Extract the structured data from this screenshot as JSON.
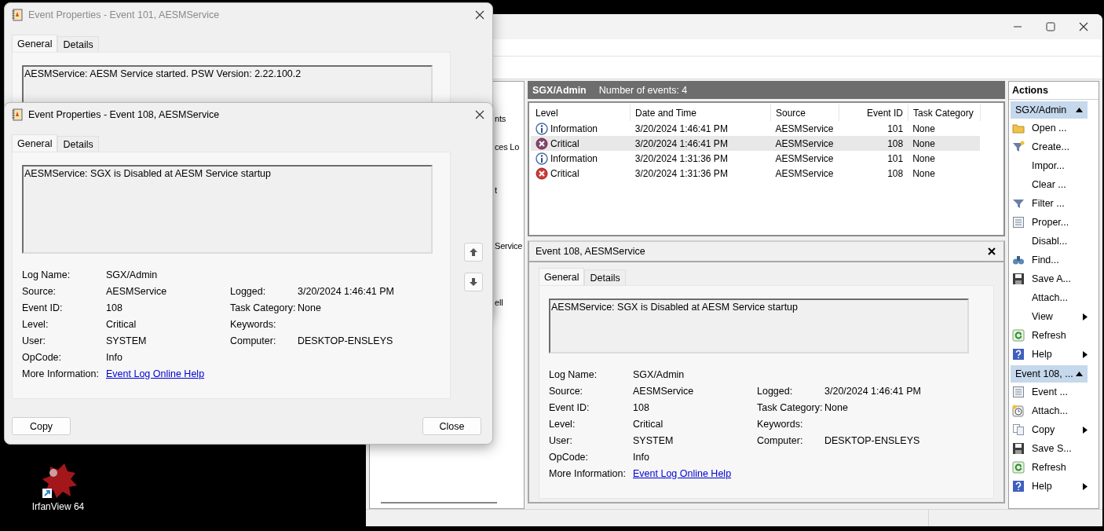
{
  "desktop": {
    "shortcut": {
      "label": "IrfanView 64"
    }
  },
  "event_viewer": {
    "tree": {
      "items": [
        "nts",
        "ces Lo",
        "t",
        "Service",
        "ell"
      ]
    },
    "log": {
      "name": "SGX/Admin",
      "summary": "Number of events: 4"
    },
    "columns": [
      "Level",
      "Date and Time",
      "Source",
      "Event ID",
      "Task Category"
    ],
    "rows": [
      {
        "kind": "information",
        "level": "Information",
        "date": "3/20/2024 1:46:41 PM",
        "source": "AESMService",
        "event_id": "101",
        "task_category": "None",
        "selected": false
      },
      {
        "kind": "critical",
        "level": "Critical",
        "date": "3/20/2024 1:46:41 PM",
        "source": "AESMService",
        "event_id": "108",
        "task_category": "None",
        "selected": true
      },
      {
        "kind": "information",
        "level": "Information",
        "date": "3/20/2024 1:31:36 PM",
        "source": "AESMService",
        "event_id": "101",
        "task_category": "None",
        "selected": false
      },
      {
        "kind": "critical",
        "level": "Critical",
        "date": "3/20/2024 1:31:36 PM",
        "source": "AESMService",
        "event_id": "108",
        "task_category": "None",
        "selected": false
      }
    ],
    "preview": {
      "title": "Event 108, AESMService",
      "tabs": [
        {
          "label": "General",
          "selected": true
        },
        {
          "label": "Details",
          "selected": false
        }
      ],
      "message": "AESMService: SGX is Disabled at AESM Service startup",
      "details": {
        "left": [
          {
            "label": "Log Name:",
            "value": "SGX/Admin"
          },
          {
            "label": "Source:",
            "value": "AESMService"
          },
          {
            "label": "Event ID:",
            "value": "108"
          },
          {
            "label": "Level:",
            "value": "Critical"
          },
          {
            "label": "User:",
            "value": "SYSTEM"
          },
          {
            "label": "OpCode:",
            "value": "Info"
          },
          {
            "label": "More Information:",
            "link": "Event Log Online Help"
          }
        ],
        "right": [
          {
            "label": "Logged:",
            "value": "3/20/2024 1:46:41 PM"
          },
          {
            "label": "Task Category:",
            "value": "None"
          },
          {
            "label": "Keywords:"
          },
          {
            "label": "Computer:",
            "value": "DESKTOP-ENSLEYS"
          }
        ]
      }
    },
    "actions": {
      "title": "Actions",
      "groups": [
        {
          "title": "SGX/Admin",
          "expanded": true,
          "items": [
            {
              "label": "Open ...",
              "kind": "folder",
              "submenu": false
            },
            {
              "label": "Create...",
              "kind": "funnel-star",
              "submenu": false
            },
            {
              "label": "Impor...",
              "submenu": false
            },
            {
              "label": "Clear ...",
              "submenu": false
            },
            {
              "label": "Filter ...",
              "kind": "funnel",
              "submenu": false
            },
            {
              "label": "Proper...",
              "kind": "document",
              "submenu": false
            },
            {
              "label": "Disabl...",
              "submenu": false
            },
            {
              "label": "Find...",
              "kind": "binoculars",
              "submenu": false
            },
            {
              "label": "Save A...",
              "kind": "floppy",
              "submenu": false
            },
            {
              "label": "Attach...",
              "submenu": false
            },
            {
              "label": "View",
              "submenu": true
            },
            {
              "label": "Refresh",
              "kind": "refresh",
              "submenu": false
            },
            {
              "label": "Help",
              "kind": "help",
              "submenu": true
            }
          ]
        },
        {
          "title": "Event 108, ...",
          "expanded": true,
          "items": [
            {
              "label": "Event ...",
              "kind": "document",
              "submenu": false
            },
            {
              "label": "Attach...",
              "kind": "clock",
              "submenu": false
            },
            {
              "label": "Copy",
              "kind": "copy",
              "submenu": true
            },
            {
              "label": "Save S...",
              "kind": "floppy",
              "submenu": false
            },
            {
              "label": "Refresh",
              "kind": "refresh",
              "submenu": false
            },
            {
              "label": "Help",
              "kind": "help",
              "submenu": true
            }
          ]
        }
      ]
    }
  },
  "dialogs": [
    {
      "title": "Event Properties - Event 101, AESMService",
      "active": false,
      "tabs": [
        {
          "label": "General",
          "selected": true
        },
        {
          "label": "Details",
          "selected": false
        }
      ],
      "message": "AESMService: AESM Service started. PSW Version: 2.22.100.2"
    },
    {
      "title": "Event Properties - Event 108, AESMService",
      "active": true,
      "tabs": [
        {
          "label": "General",
          "selected": true
        },
        {
          "label": "Details",
          "selected": false
        }
      ],
      "message": "AESMService: SGX is Disabled at AESM Service startup",
      "details": {
        "left": [
          {
            "label": "Log Name:",
            "value": "SGX/Admin"
          },
          {
            "label": "Source:",
            "value": "AESMService"
          },
          {
            "label": "Event ID:",
            "value": "108"
          },
          {
            "label": "Level:",
            "value": "Critical"
          },
          {
            "label": "User:",
            "value": "SYSTEM"
          },
          {
            "label": "OpCode:",
            "value": "Info"
          },
          {
            "label": "More Information:",
            "link": "Event Log Online Help"
          }
        ],
        "right": [
          {
            "label": "Logged:",
            "value": "3/20/2024 1:46:41 PM"
          },
          {
            "label": "Task Category:",
            "value": "None"
          },
          {
            "label": "Keywords:"
          },
          {
            "label": "Computer:",
            "value": "DESKTOP-ENSLEYS"
          }
        ]
      },
      "buttons": [
        "Copy",
        "Close"
      ]
    }
  ]
}
